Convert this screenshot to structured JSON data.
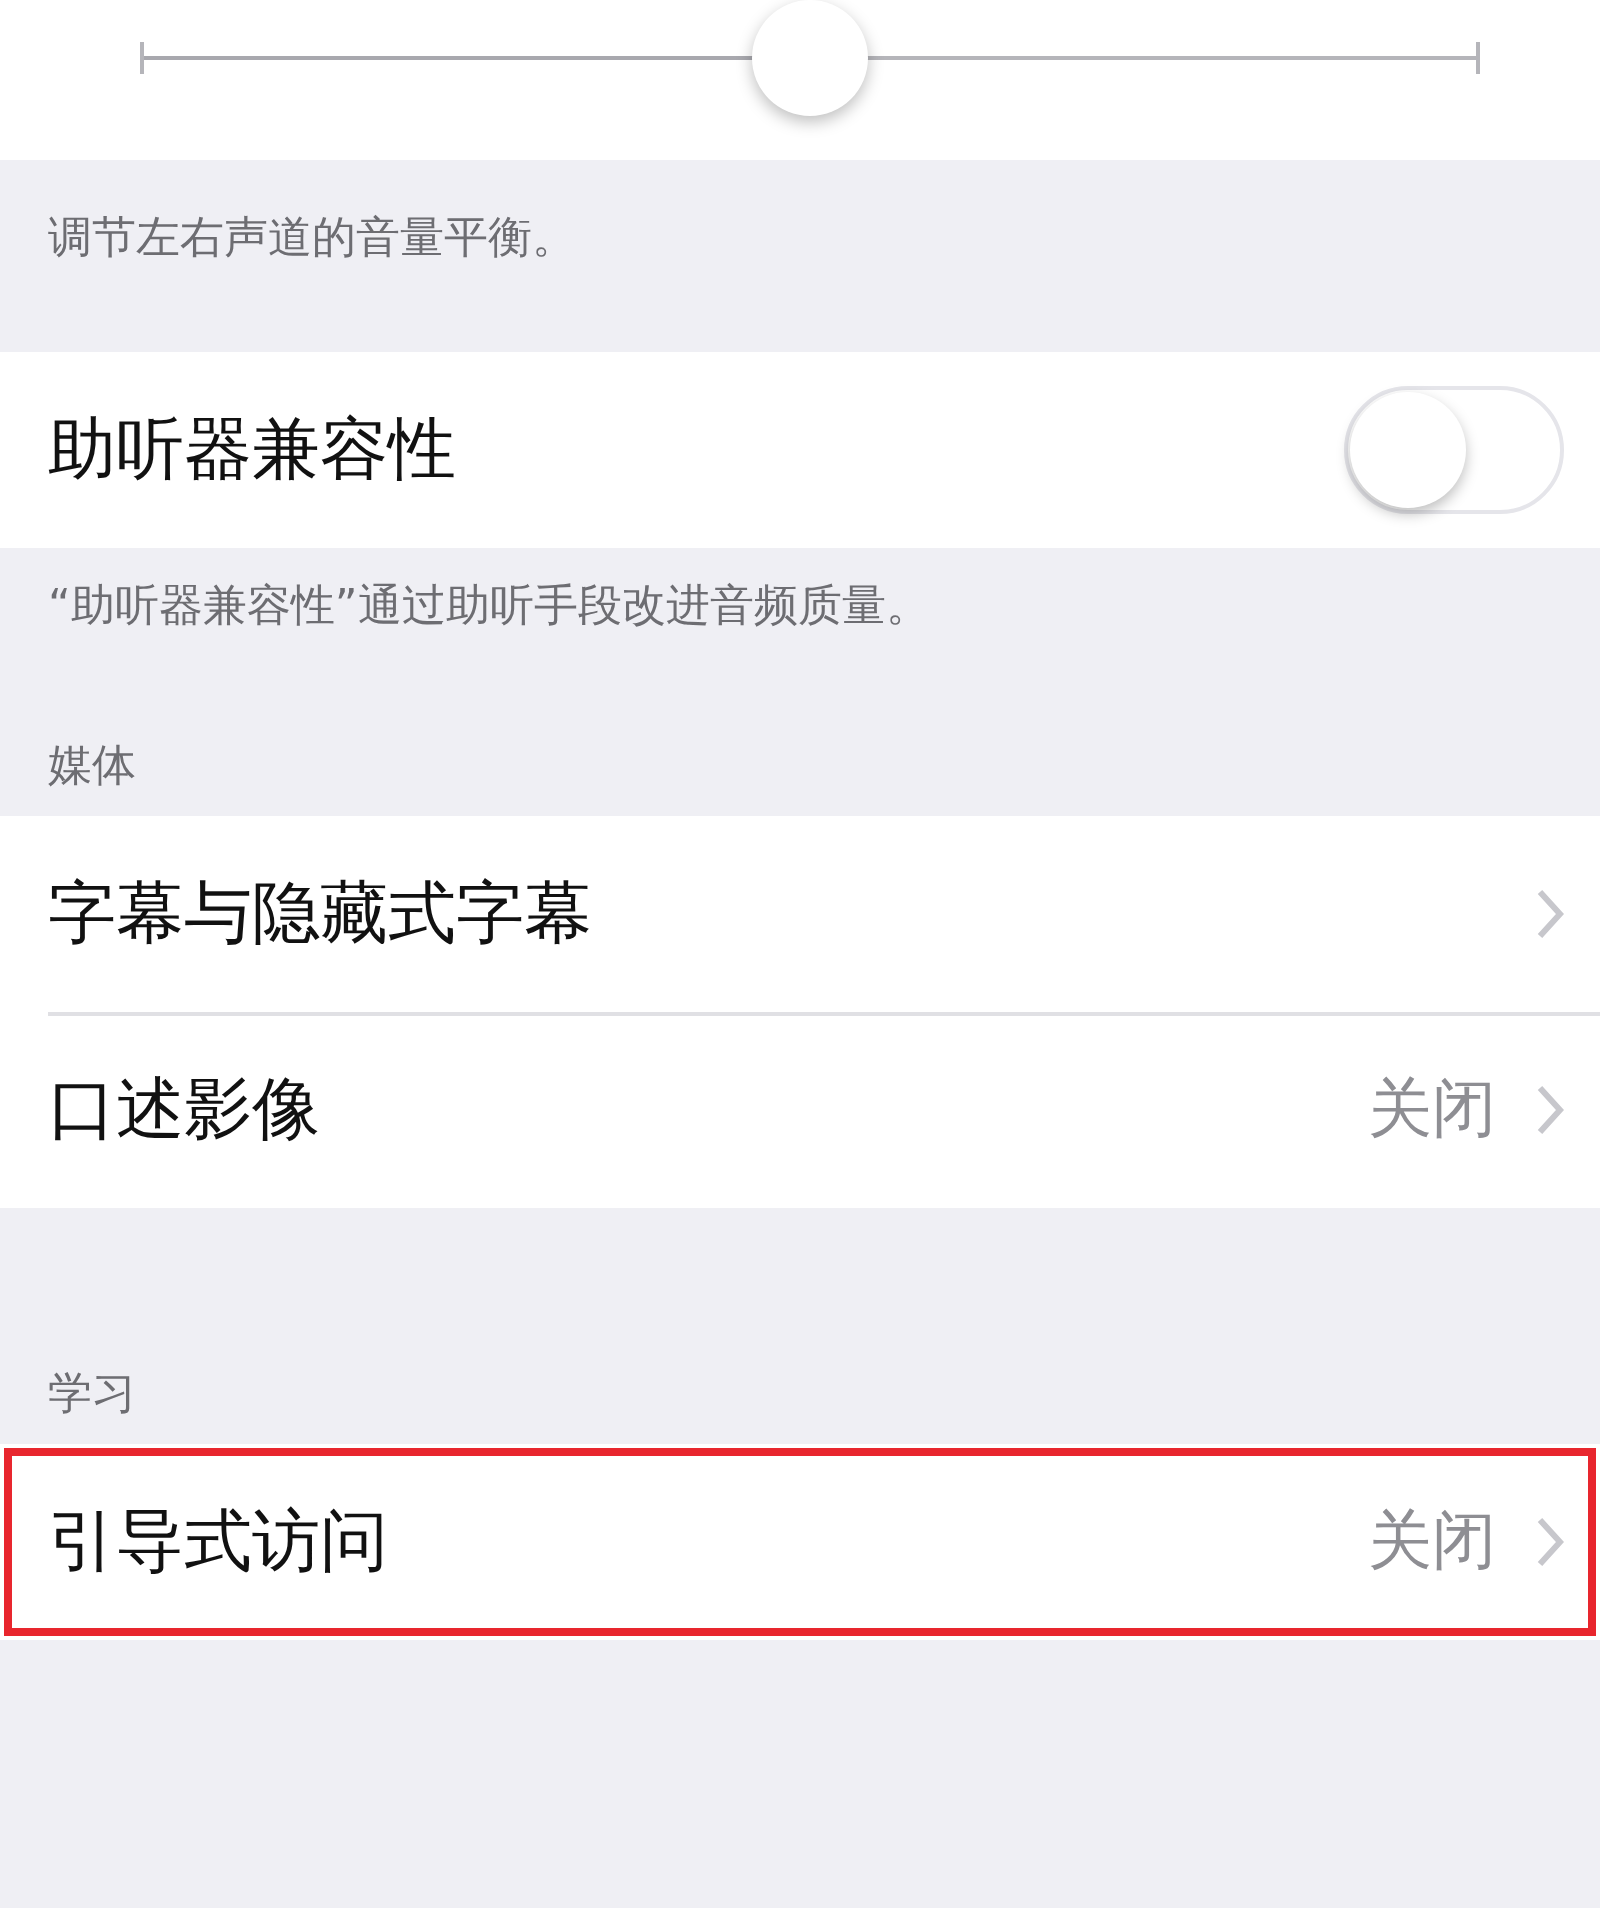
{
  "balance_slider": {
    "level": 0.5
  },
  "balance_note": "调节左右声道的音量平衡。",
  "hearing_aid": {
    "label": "助听器兼容性",
    "on": false
  },
  "hearing_aid_note": "“助听器兼容性”通过助听手段改进音频质量。",
  "sections": [
    {
      "header": "媒体",
      "rows": [
        {
          "label": "字幕与隐藏式字幕",
          "highlighted": false
        },
        {
          "label": "口述影像",
          "value": "关闭",
          "highlighted": false
        }
      ]
    },
    {
      "header": "学习",
      "rows": [
        {
          "label": "引导式访问",
          "value": "关闭",
          "highlighted": true
        }
      ]
    }
  ]
}
